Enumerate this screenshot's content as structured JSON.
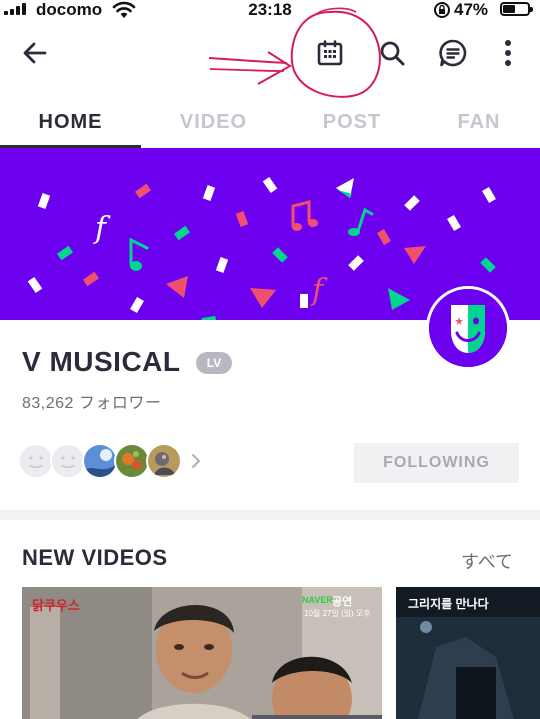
{
  "status_bar": {
    "carrier": "docomo",
    "time": "23:18",
    "battery": "47%"
  },
  "header": {
    "back_icon": "back-arrow-icon",
    "actions": [
      "calendar-icon",
      "search-icon",
      "chat-icon",
      "more-vertical-icon"
    ],
    "annotation_color": "#d81b60"
  },
  "tabs": [
    {
      "label": "HOME",
      "active": true
    },
    {
      "label": "VIDEO",
      "active": false
    },
    {
      "label": "POST",
      "active": false
    },
    {
      "label": "FAN",
      "active": false
    }
  ],
  "banner": {
    "background": "#6e00f0"
  },
  "channel": {
    "name": "V MUSICAL",
    "badge": "LV",
    "followers": "83,262 フォロワー"
  },
  "follow_button": {
    "label": "FOLLOWING"
  },
  "new_videos": {
    "title": "NEW VIDEOS",
    "more_label": "すべて",
    "items": [
      {
        "title_text": "닭쿠우스",
        "overlay_brand": "NAVER",
        "overlay_text": "공연",
        "overlay_sub": "10월 27일 (일) 오후"
      },
      {
        "title_text": "그리지를 만나다"
      }
    ]
  }
}
